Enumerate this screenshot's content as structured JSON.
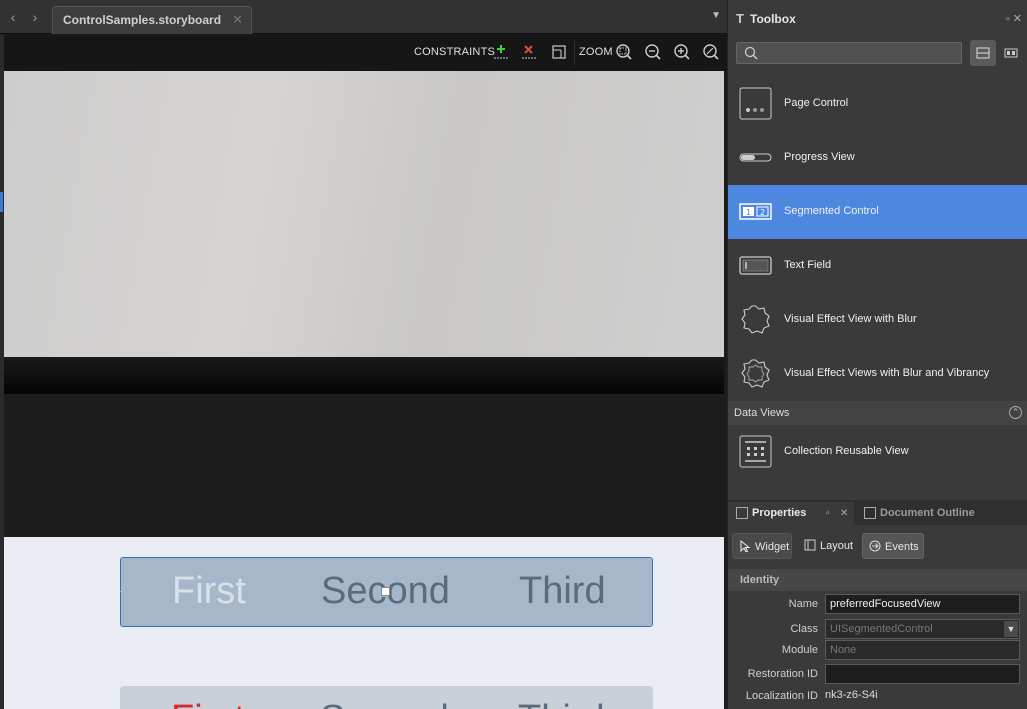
{
  "editor": {
    "tab_title": "ControlSamples.storyboard",
    "tab_close": "✕",
    "nav_back": "‹",
    "nav_forward": "›",
    "tab_menu": "▼",
    "toolbar": {
      "constraints_label": "CONSTRAINTS",
      "zoom_label": "ZOOM"
    }
  },
  "canvas": {
    "segmented_primary": [
      "First",
      "Second",
      "Third"
    ],
    "segmented_secondary": [
      "First",
      "Second",
      "Third"
    ],
    "selection_color": "#3c6fb0"
  },
  "toolbox": {
    "title": "Toolbox",
    "search_placeholder": "",
    "items": [
      {
        "label": "Page Control",
        "icon": "page-control-icon"
      },
      {
        "label": "Progress View",
        "icon": "progress-view-icon"
      },
      {
        "label": "Segmented Control",
        "icon": "segmented-control-icon",
        "selected": true
      },
      {
        "label": "Text Field",
        "icon": "text-field-icon"
      },
      {
        "label": "Visual Effect View with Blur",
        "icon": "visual-effect-icon"
      },
      {
        "label": "Visual Effect Views with Blur and Vibrancy",
        "icon": "visual-effect-vibrancy-icon"
      }
    ],
    "section": "Data Views",
    "section_items": [
      {
        "label": "Collection Reusable View",
        "icon": "collection-reusable-view-icon"
      }
    ],
    "selected_color": "#4d87e0"
  },
  "properties": {
    "tab_label": "Properties",
    "outline_tab_label": "Document Outline",
    "buttons": [
      "Widget",
      "Layout",
      "Events"
    ],
    "identity_header": "Identity",
    "fields": {
      "name_label": "Name",
      "name_value": "preferredFocusedView",
      "class_label": "Class",
      "class_value": "UISegmentedControl",
      "module_label": "Module",
      "module_placeholder": "None",
      "restoration_label": "Restoration ID",
      "restoration_value": "",
      "localization_label": "Localization ID",
      "localization_value": "nk3-z6-S4i"
    }
  }
}
